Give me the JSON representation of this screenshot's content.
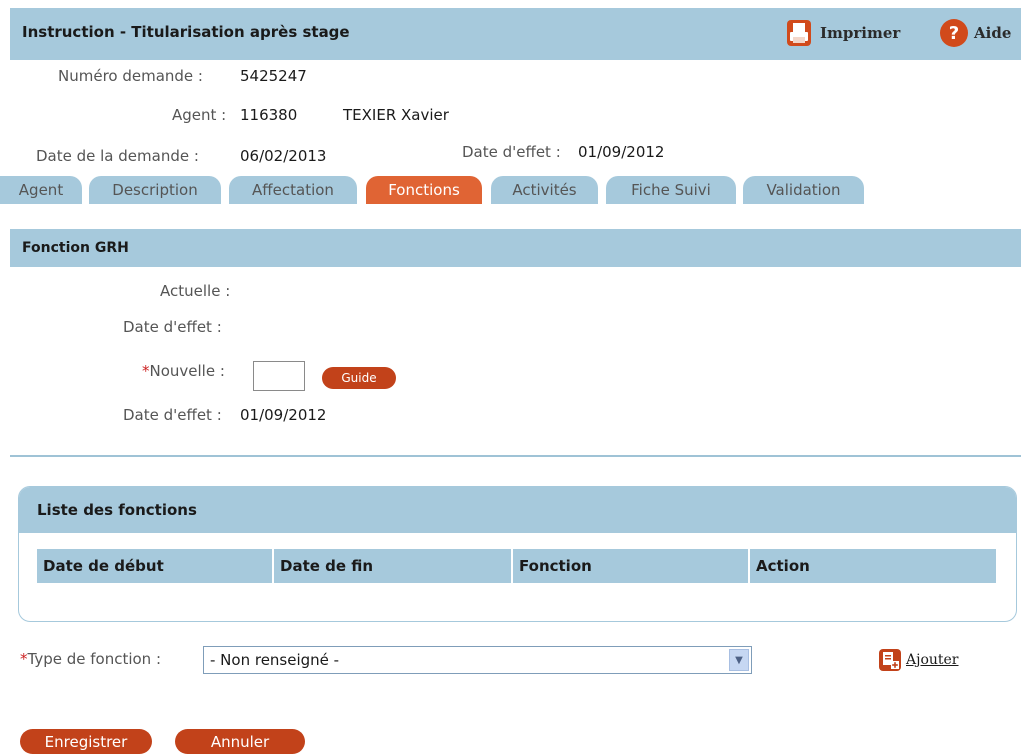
{
  "header": {
    "title": "Instruction - Titularisation après stage",
    "print_label": "Imprimer",
    "help_label": "Aide"
  },
  "info": {
    "numero_label": "Numéro demande :",
    "numero_value": "5425247",
    "agent_label": "Agent :",
    "agent_id": "116380",
    "agent_name": "TEXIER Xavier",
    "date_demande_label": "Date de la demande :",
    "date_demande_value": "06/02/2013",
    "date_effet_label": "Date d'effet :",
    "date_effet_value": "01/09/2012"
  },
  "tabs": [
    {
      "label": "Agent",
      "active": false
    },
    {
      "label": "Description",
      "active": false
    },
    {
      "label": "Affectation",
      "active": false
    },
    {
      "label": "Fonctions",
      "active": true
    },
    {
      "label": "Activités",
      "active": false
    },
    {
      "label": "Fiche Suivi",
      "active": false
    },
    {
      "label": "Validation",
      "active": false
    }
  ],
  "fonction_grh": {
    "title": "Fonction GRH",
    "actuelle_label": "Actuelle :",
    "date_effet_label": "Date d'effet :",
    "required_mark": "*",
    "nouvelle_label": "Nouvelle :",
    "nouvelle_value": "",
    "guide_label": "Guide",
    "date_effet2_label": "Date d'effet :",
    "date_effet2_value": "01/09/2012"
  },
  "liste": {
    "title": "Liste des fonctions",
    "columns": [
      "Date de début",
      "Date de fin",
      "Fonction",
      "Action"
    ]
  },
  "type_fonction": {
    "required_mark": "*",
    "label": "Type de fonction :",
    "selected": "- Non renseigné -"
  },
  "add_label": "Ajouter",
  "buttons": {
    "save": "Enregistrer",
    "cancel": "Annuler"
  },
  "colors": {
    "header_blue": "#a6c9dc",
    "active_tab": "#e06434",
    "button_red": "#c2421a"
  }
}
